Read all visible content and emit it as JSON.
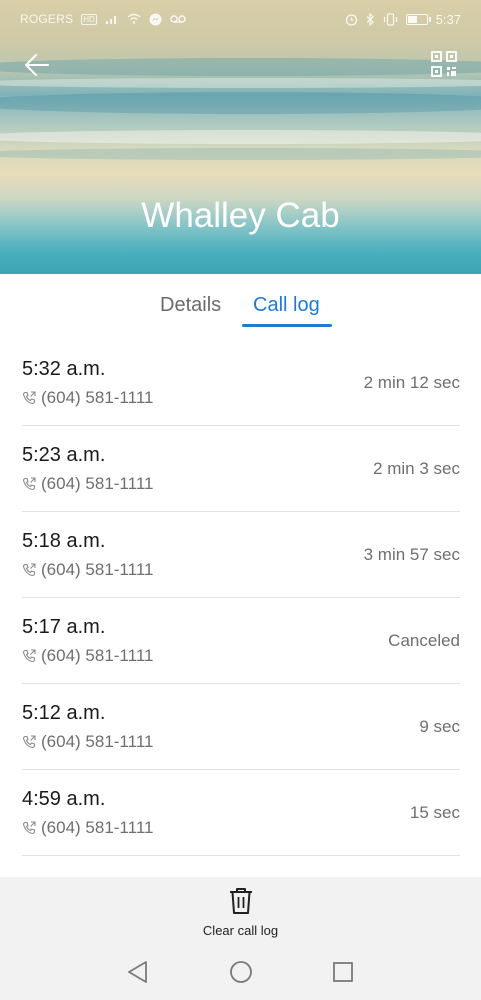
{
  "status_bar": {
    "carrier": "ROGERS",
    "network_badge": "HD",
    "time": "5:37",
    "battery_level": 0.55,
    "icons": [
      "signal-icon",
      "wifi-icon",
      "messenger-icon",
      "voicemail-icon",
      "alarm-icon",
      "bluetooth-icon",
      "vibrate-icon",
      "battery-icon"
    ]
  },
  "header": {
    "contact_name": "Whalley Cab",
    "back_icon": "back-arrow-icon",
    "qr_icon": "qr-code-icon"
  },
  "tabs": [
    {
      "label": "Details",
      "active": false
    },
    {
      "label": "Call log",
      "active": true
    }
  ],
  "call_log": [
    {
      "time": "5:32 a.m.",
      "number": "(604) 581-1111",
      "duration": "2 min 12 sec"
    },
    {
      "time": "5:23 a.m.",
      "number": "(604) 581-1111",
      "duration": "2 min 3 sec"
    },
    {
      "time": "5:18 a.m.",
      "number": "(604) 581-1111",
      "duration": "3 min 57 sec"
    },
    {
      "time": "5:17 a.m.",
      "number": "(604) 581-1111",
      "duration": "Canceled"
    },
    {
      "time": "5:12 a.m.",
      "number": "(604) 581-1111",
      "duration": "9 sec"
    },
    {
      "time": "4:59 a.m.",
      "number": "(604) 581-1111",
      "duration": "15 sec"
    }
  ],
  "bottom_bar": {
    "clear_label": "Clear call log",
    "clear_icon": "trash-icon"
  },
  "nav": {
    "icons": [
      "nav-back-icon",
      "nav-home-icon",
      "nav-recents-icon"
    ]
  },
  "colors": {
    "accent": "#1e7bd4",
    "secondary_text": "#6f6f6f",
    "bottom_bar_bg": "#f2f2f2"
  }
}
